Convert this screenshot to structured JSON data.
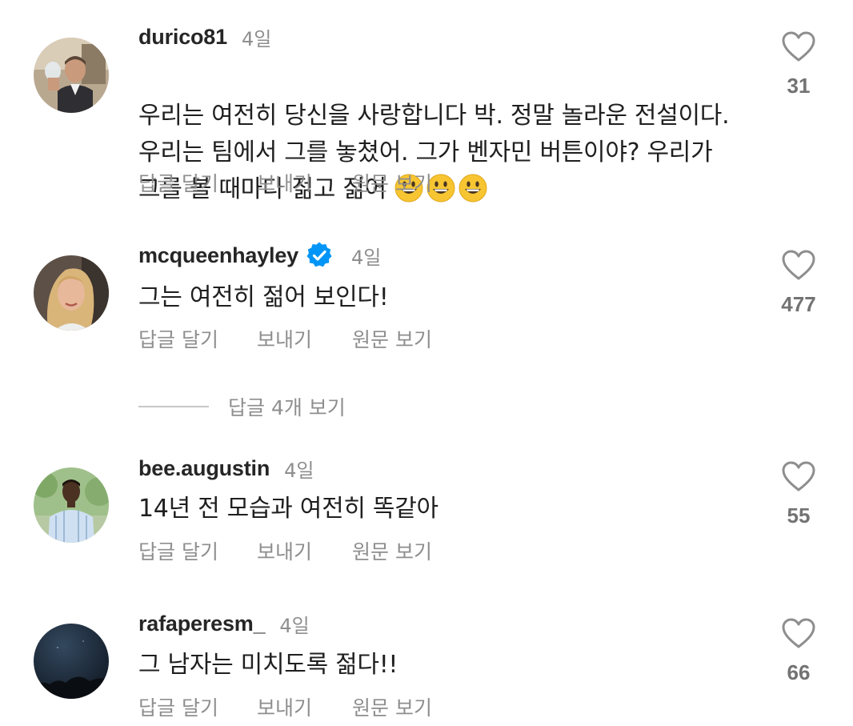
{
  "comments": [
    {
      "username": "durico81",
      "time": "4일",
      "verified": false,
      "text": "우리는 여전히 당신을 사랑합니다 박. 정말 놀라운 전설이다.\n우리는 팀에서 그를 놓쳤어. 그가 벤자민 버튼이야? 우리가\n그를 볼 때마다 젊고 젊어",
      "emoji": [
        "grinning-face-emoji",
        "grinning-face-emoji",
        "grinning-face-emoji"
      ],
      "likes": "31",
      "avatar": "avatar-man-with-bottle"
    },
    {
      "username": "mcqueenhayley",
      "time": "4일",
      "verified": true,
      "text": "그는 여전히 젊어 보인다!",
      "likes": "477",
      "avatar": "avatar-woman-blonde"
    },
    {
      "username": "bee.augustin",
      "time": "4일",
      "verified": false,
      "text": "14년 전 모습과 여전히 똑같아",
      "likes": "55",
      "avatar": "avatar-man-striped-shirt"
    },
    {
      "username": "rafaperesm_",
      "time": "4일",
      "verified": false,
      "text": "그 남자는 미치도록 젊다!!",
      "likes": "66",
      "avatar": "avatar-night-sky"
    }
  ],
  "actions": {
    "reply": "답글 달기",
    "send": "보내기",
    "see_original": "원문 보기"
  },
  "view_replies": "답글 4개 보기",
  "colors": {
    "text": "#1f1f1f",
    "muted": "#8e8e8e",
    "verified_blue": "#0095f6",
    "emoji_yellow": "#f7c531"
  },
  "icons": {
    "like": "heart-outline-icon",
    "verified": "verified-badge-icon"
  }
}
